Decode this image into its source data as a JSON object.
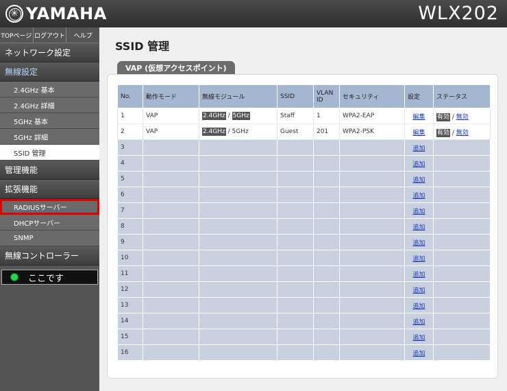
{
  "header": {
    "brand": "YAMAHA",
    "model": "WLX202"
  },
  "sidebar": {
    "topnav": [
      "TOPページ",
      "ログアウト",
      "ヘルプ"
    ],
    "sections": [
      {
        "label": "ネットワーク設定",
        "items": []
      },
      {
        "label": "無線設定",
        "items": [
          "2.4GHz 基本",
          "2.4GHz 詳細",
          "5GHz 基本",
          "5GHz 詳細",
          "SSID 管理"
        ]
      },
      {
        "label": "管理機能",
        "items": []
      },
      {
        "label": "拡張機能",
        "items": [
          "RADIUSサーバー",
          "DHCPサーバー",
          "SNMP"
        ]
      },
      {
        "label": "無線コントローラー",
        "items": []
      }
    ],
    "here_label": "ここです"
  },
  "main": {
    "title": "SSID 管理",
    "tab": "VAP (仮想アクセスポイント)",
    "columns": [
      "No.",
      "動作モード",
      "無線モジュール",
      "SSID",
      "VLAN ID",
      "セキュリティ",
      "設定",
      "ステータス"
    ],
    "rows": [
      {
        "no": "1",
        "mode": "VAP",
        "mod_a": "2.4GHz",
        "mod_sep": " / ",
        "mod_b": "5GHz",
        "ssid": "Staff",
        "vlan": "1",
        "security": "WPA2-EAP",
        "action": "編集",
        "status_a": "有効",
        "status_sep": " / ",
        "status_b": "無効"
      },
      {
        "no": "2",
        "mode": "VAP",
        "mod_a": "2.4GHz",
        "mod_sep": " / ",
        "mod_b": "5GHz",
        "ssid": "Guest",
        "vlan": "201",
        "security": "WPA2-PSK",
        "action": "編集",
        "status_a": "有効",
        "status_sep": " / ",
        "status_b": "無効"
      },
      {
        "no": "3",
        "action": "追加"
      },
      {
        "no": "4",
        "action": "追加"
      },
      {
        "no": "5",
        "action": "追加"
      },
      {
        "no": "6",
        "action": "追加"
      },
      {
        "no": "7",
        "action": "追加"
      },
      {
        "no": "8",
        "action": "追加"
      },
      {
        "no": "9",
        "action": "追加"
      },
      {
        "no": "10",
        "action": "追加"
      },
      {
        "no": "11",
        "action": "追加"
      },
      {
        "no": "12",
        "action": "追加"
      },
      {
        "no": "13",
        "action": "追加"
      },
      {
        "no": "14",
        "action": "追加"
      },
      {
        "no": "15",
        "action": "追加"
      },
      {
        "no": "16",
        "action": "追加"
      }
    ]
  }
}
